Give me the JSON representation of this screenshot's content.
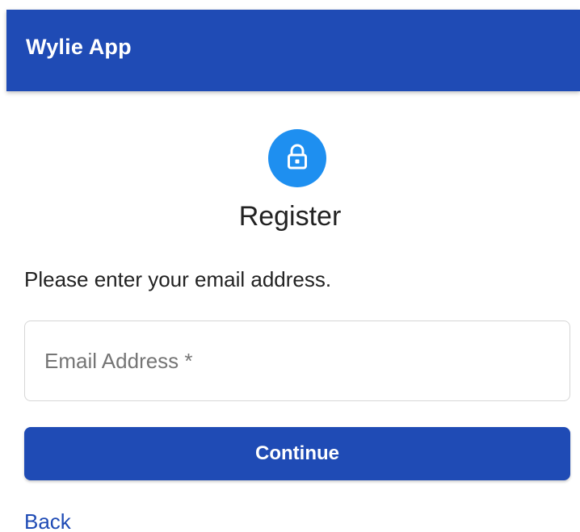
{
  "app": {
    "title": "Wylie App"
  },
  "form": {
    "icon": "lock-icon",
    "heading": "Register",
    "instructions": "Please enter your email address.",
    "email_placeholder": "Email Address *",
    "email_value": "",
    "continue_label": "Continue",
    "back_label": "Back"
  },
  "colors": {
    "brand_primary": "#1f4bb5",
    "icon_circle": "#1e8ff0",
    "text": "#222222",
    "placeholder": "#757575",
    "border": "#d6d6d6"
  }
}
